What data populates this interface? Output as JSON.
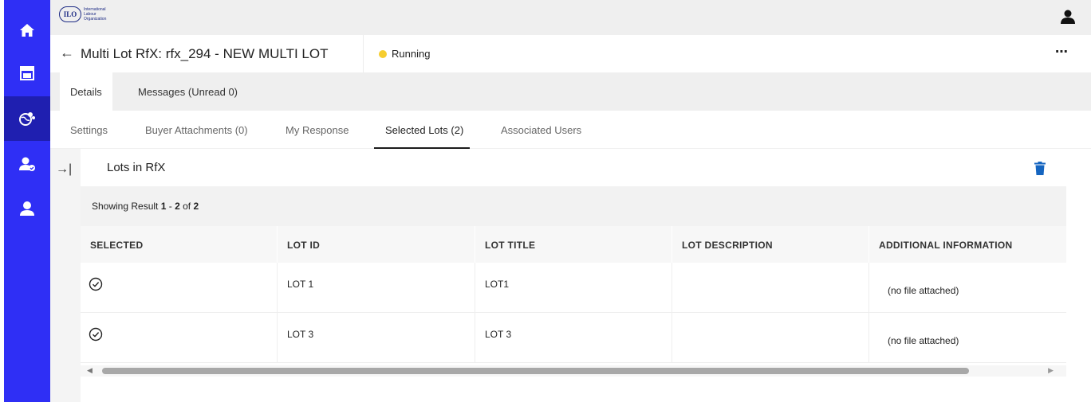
{
  "nav": {
    "items": [
      {
        "name": "home",
        "icon": "home-icon"
      },
      {
        "name": "dashboard",
        "icon": "layout-icon"
      },
      {
        "name": "sourcing",
        "icon": "globe-network-icon"
      },
      {
        "name": "user-approve",
        "icon": "user-check-icon"
      },
      {
        "name": "profile",
        "icon": "user-icon"
      }
    ],
    "active_index": 2
  },
  "header": {
    "logo_mark": "ILO",
    "logo_lines": [
      "International",
      "Labour",
      "Organization"
    ]
  },
  "titlebar": {
    "back_glyph": "←",
    "title": "Multi Lot RfX: rfx_294 - NEW MULTI LOT",
    "status": "Running",
    "more_glyph": "⋯"
  },
  "tabs_primary": [
    {
      "label": "Details",
      "active": true
    },
    {
      "label": "Messages (Unread 0)",
      "active": false
    }
  ],
  "tabs_secondary": [
    {
      "label": "Settings",
      "active": false
    },
    {
      "label": "Buyer Attachments (0)",
      "active": false
    },
    {
      "label": "My Response",
      "active": false
    },
    {
      "label": "Selected Lots (2)",
      "active": true
    },
    {
      "label": "Associated Users",
      "active": false
    }
  ],
  "panel": {
    "collapse_glyph": "→|",
    "title": "Lots in RfX",
    "results": {
      "prefix": "Showing Result ",
      "start": "1",
      "sep": " - ",
      "end": "2",
      "of": " of ",
      "total": "2"
    }
  },
  "table": {
    "columns": [
      "SELECTED",
      "LOT ID",
      "LOT TITLE",
      "LOT DESCRIPTION",
      "ADDITIONAL INFORMATION"
    ],
    "rows": [
      {
        "lot_id": "LOT 1",
        "lot_title": "LOT1",
        "lot_description": "",
        "additional_info": "(no file attached)"
      },
      {
        "lot_id": "LOT 3",
        "lot_title": "LOT 3",
        "lot_description": "",
        "additional_info": "(no file attached)"
      }
    ]
  },
  "colors": {
    "nav_bg": "#2f2ff5",
    "nav_active": "#1f1fb0",
    "status_running": "#f6cd2f",
    "delete_icon": "#1565c0"
  }
}
